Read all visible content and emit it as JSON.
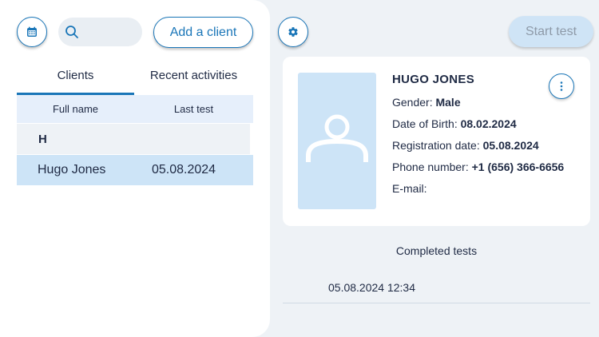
{
  "toolbar": {
    "calendar_icon": "calendar-icon",
    "search_icon": "search-icon",
    "search_placeholder": "",
    "add_client_label": "Add a client",
    "settings_icon": "gear-icon",
    "start_test_label": "Start test"
  },
  "tabs": [
    {
      "label": "Clients",
      "active": true
    },
    {
      "label": "Recent activities",
      "active": false
    }
  ],
  "table": {
    "columns": [
      "Full name",
      "Last test"
    ],
    "groups": [
      {
        "letter": "H",
        "rows": [
          {
            "name": "Hugo Jones",
            "last_test": "05.08.2024",
            "selected": true
          }
        ]
      }
    ]
  },
  "client": {
    "name": "HUGO JONES",
    "gender_label": "Gender:",
    "gender": "Male",
    "dob_label": "Date of Birth:",
    "dob": "08.02.2024",
    "registration_label": "Registration date:",
    "registration": "05.08.2024",
    "phone_label": "Phone number:",
    "phone": "+1 (656) 366-6656",
    "email_label": "E-mail:",
    "email": ""
  },
  "completed_tests": {
    "title": "Completed tests",
    "items": [
      "05.08.2024 12:34"
    ]
  },
  "colors": {
    "accent": "#1a76b8",
    "selected_row": "#cde4f7",
    "header_row": "#e6effb",
    "background": "#eef2f6"
  }
}
